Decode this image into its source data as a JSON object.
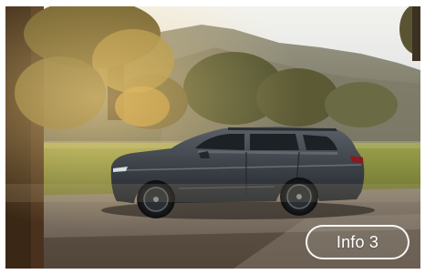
{
  "hero_card": {
    "image_icon": "suv-driving-photo-icon",
    "info_button_label": "Info 3"
  },
  "colors": {
    "sky": "#e9edf0",
    "mountains": "#8d8a78",
    "grass": "#8a8f3b",
    "road": "#7c7368",
    "car_body": "#3f444b",
    "button_border": "#ffffff"
  }
}
